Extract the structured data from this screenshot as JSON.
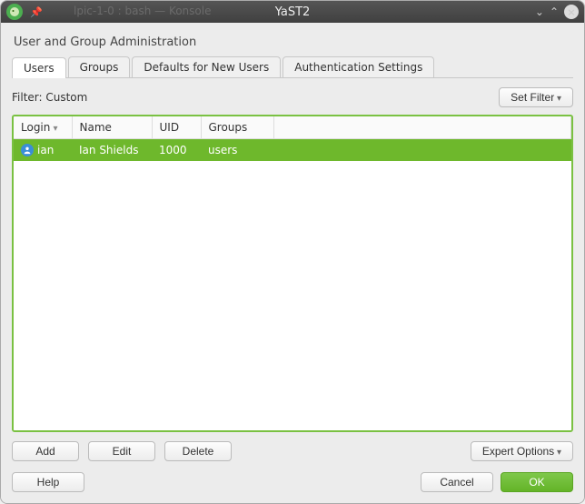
{
  "titlebar": {
    "bg_text": "lpic-1-0 : bash — Konsole",
    "title": "YaST2"
  },
  "module_title": "User and Group Administration",
  "tabs": [
    {
      "label": "Users",
      "active": true
    },
    {
      "label": "Groups",
      "active": false
    },
    {
      "label": "Defaults for New Users",
      "active": false
    },
    {
      "label": "Authentication Settings",
      "active": false
    }
  ],
  "filter": {
    "label": "Filter: Custom",
    "set_filter": "Set Filter"
  },
  "table": {
    "headers": {
      "login": "Login",
      "name": "Name",
      "uid": "UID",
      "groups": "Groups"
    },
    "rows": [
      {
        "login": "ian",
        "name": "Ian Shields",
        "uid": "1000",
        "groups": "users",
        "selected": true
      }
    ]
  },
  "actions": {
    "add": "Add",
    "edit": "Edit",
    "delete": "Delete",
    "expert": "Expert Options"
  },
  "bottom": {
    "help": "Help",
    "cancel": "Cancel",
    "ok": "OK"
  }
}
